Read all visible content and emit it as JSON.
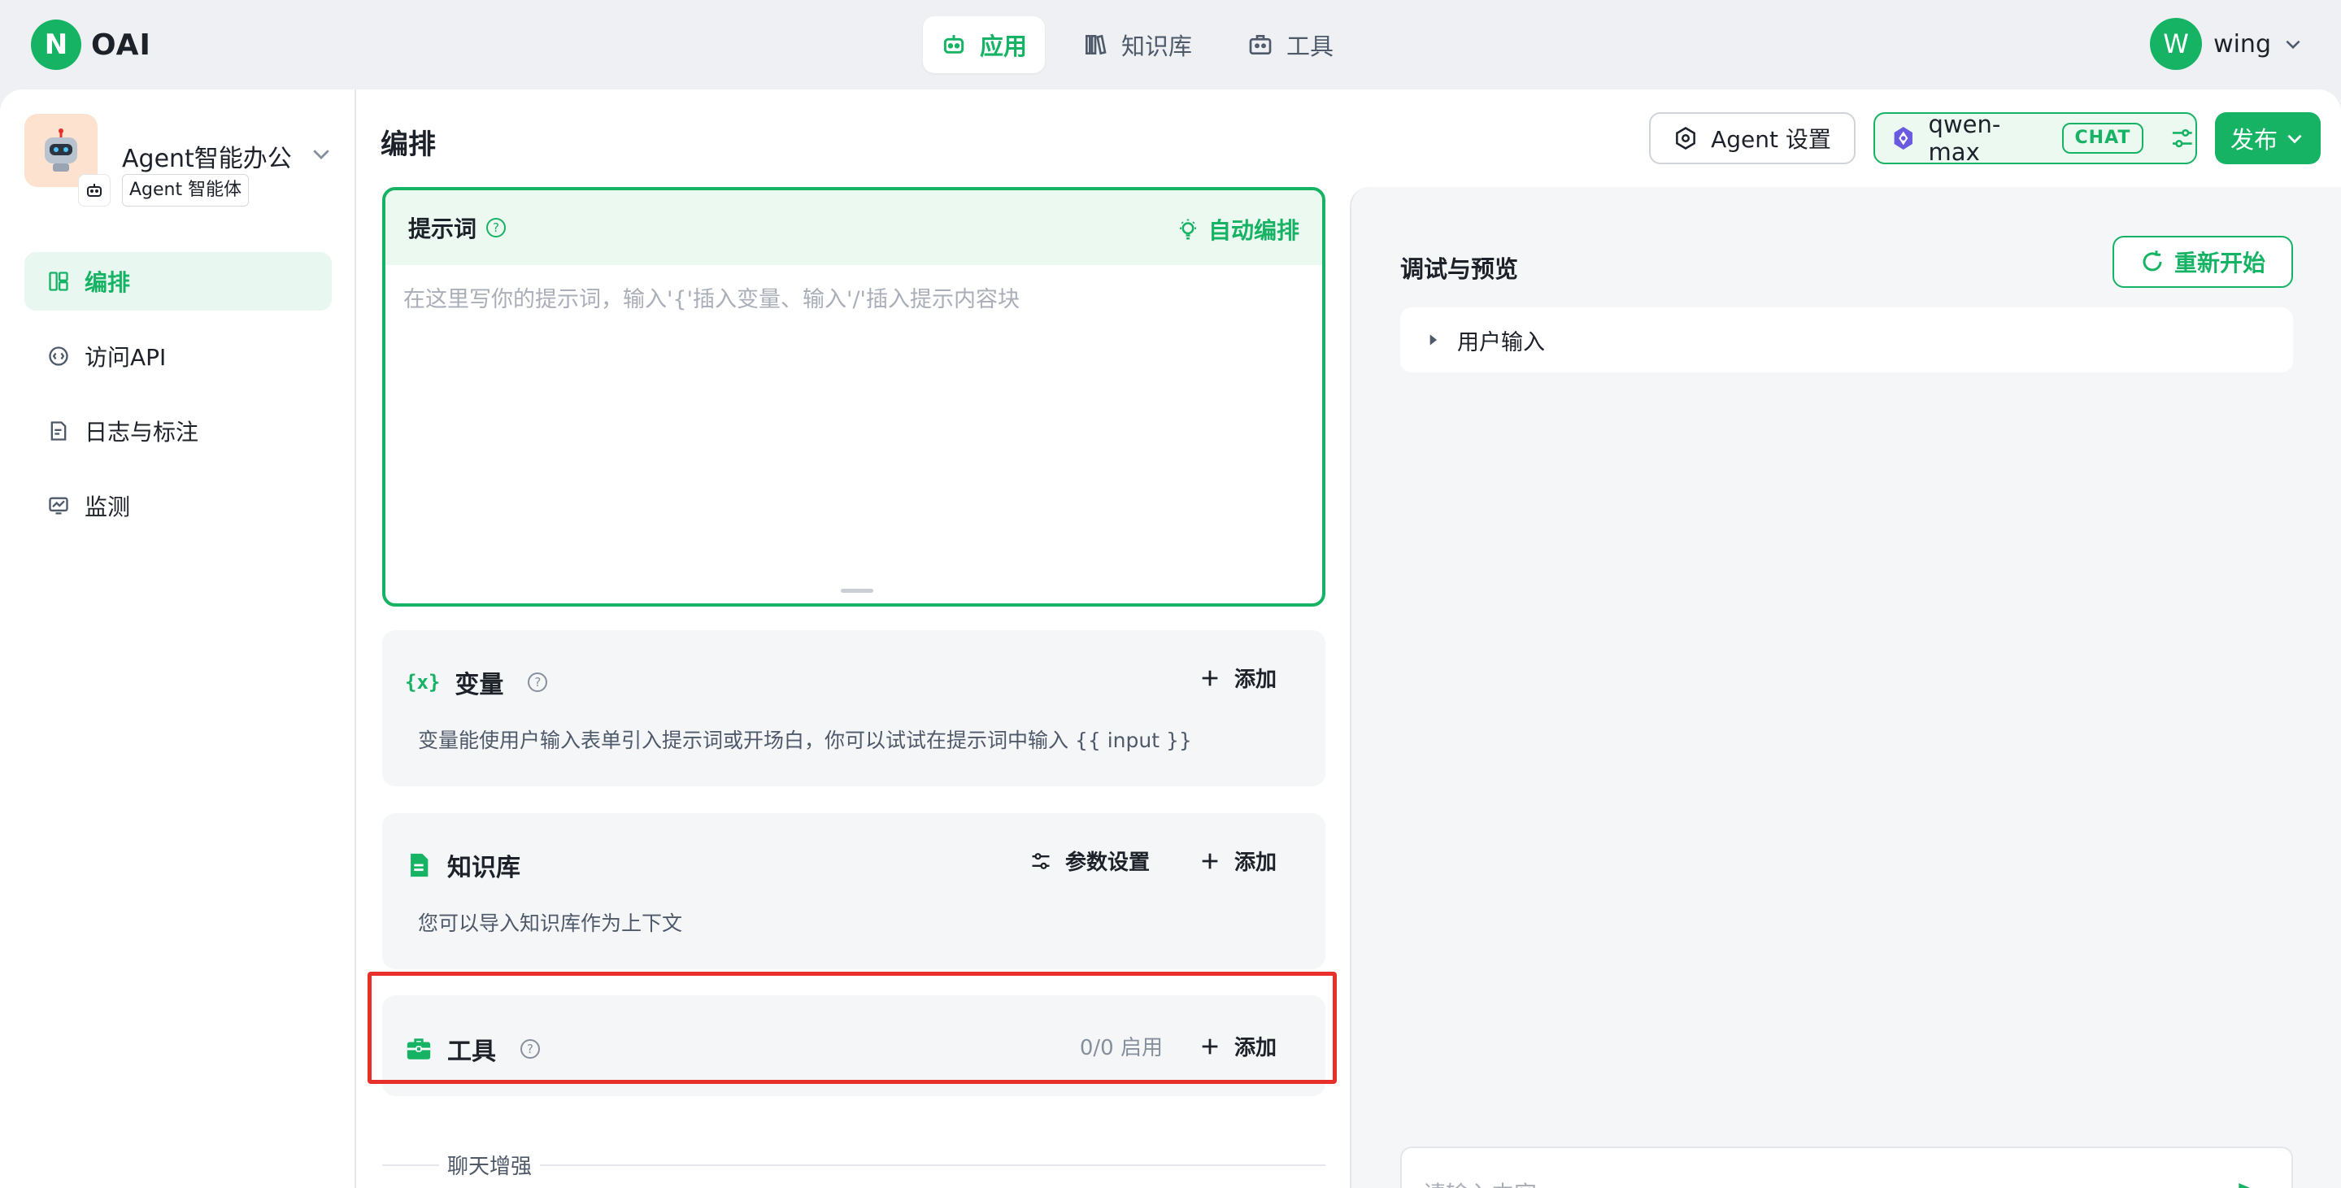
{
  "brand": {
    "logo_letter": "N",
    "name": "OAI"
  },
  "nav": {
    "items": [
      {
        "label": "应用",
        "icon": "robot-icon",
        "active": true
      },
      {
        "label": "知识库",
        "icon": "book-icon",
        "active": false
      },
      {
        "label": "工具",
        "icon": "toolbox-icon",
        "active": false
      }
    ]
  },
  "user": {
    "initial": "W",
    "name": "wing"
  },
  "app": {
    "name": "Agent智能办公",
    "tag": "Agent 智能体"
  },
  "sidebar": {
    "items": [
      {
        "label": "编排",
        "icon": "layout-icon",
        "active": true
      },
      {
        "label": "访问API",
        "icon": "api-icon",
        "active": false
      },
      {
        "label": "日志与标注",
        "icon": "log-icon",
        "active": false
      },
      {
        "label": "监测",
        "icon": "monitor-icon",
        "active": false
      }
    ]
  },
  "editor": {
    "title": "编排",
    "prompt": {
      "title": "提示词",
      "auto_label": "自动编排",
      "placeholder": "在这里写你的提示词，输入'{'插入变量、输入'/'插入提示内容块"
    },
    "variables": {
      "icon_text": "{x}",
      "title": "变量",
      "add_label": "添加",
      "desc": "变量能使用户输入表单引入提示词或开场白，你可以试试在提示词中输入 {{ input }}"
    },
    "knowledge": {
      "title": "知识库",
      "params_label": "参数设置",
      "add_label": "添加",
      "desc": "您可以导入知识库作为上下文"
    },
    "tools": {
      "title": "工具",
      "status": "0/0 启用",
      "add_label": "添加"
    },
    "chat_enhance": "聊天增强"
  },
  "header": {
    "agent_settings_label": "Agent 设置",
    "model_name": "qwen-max",
    "model_badge": "CHAT",
    "publish_label": "发布"
  },
  "debug": {
    "title": "调试与预览",
    "restart_label": "重新开始",
    "user_input_label": "用户输入",
    "input_placeholder": "请输入内容"
  },
  "colors": {
    "accent": "#16b364",
    "highlight": "#e8302a"
  }
}
